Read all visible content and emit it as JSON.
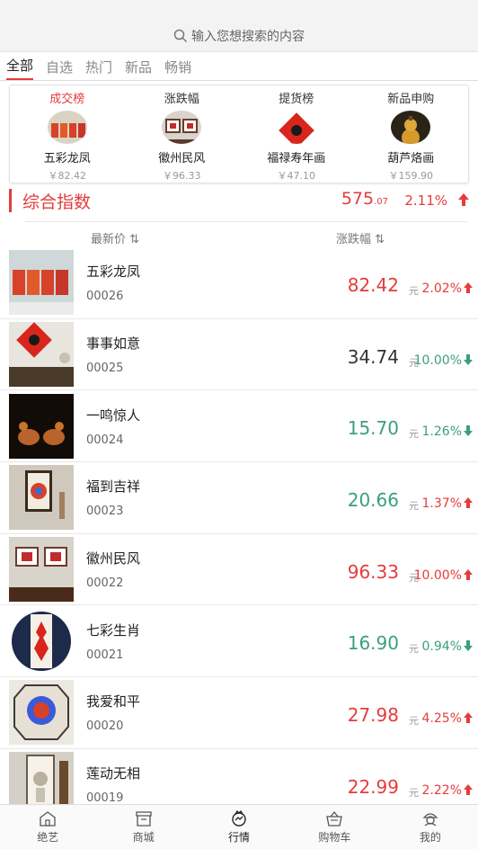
{
  "search": {
    "placeholder": "输入您想搜索的内容"
  },
  "tabs": [
    {
      "label": "全部",
      "active": true
    },
    {
      "label": "自选"
    },
    {
      "label": "热门"
    },
    {
      "label": "新品"
    },
    {
      "label": "畅销"
    }
  ],
  "rankings": [
    {
      "title": "成交榜",
      "name": "五彩龙凤",
      "price": "￥82.42",
      "active": true
    },
    {
      "title": "涨跌幅",
      "name": "徽州民风",
      "price": "￥96.33"
    },
    {
      "title": "提货榜",
      "name": "福禄寿年画",
      "price": "￥47.10"
    },
    {
      "title": "新品申购",
      "name": "葫芦烙画",
      "price": "￥159.90"
    }
  ],
  "index": {
    "title": "综合指数",
    "value_main": "575",
    "value_decimal": ".07",
    "change": "2.11%"
  },
  "sort": {
    "price_label": "最新价 ⇅",
    "change_label": "涨跌幅 ⇅"
  },
  "products": [
    {
      "name": "五彩龙凤",
      "code": "00026",
      "price": "82.42",
      "unit": "元",
      "change": "2.02%",
      "dir": "up"
    },
    {
      "name": "事事如意",
      "code": "00025",
      "price": "34.74",
      "unit": "元",
      "change": "10.00%",
      "dir": "down"
    },
    {
      "name": "一鸣惊人",
      "code": "00024",
      "price": "15.70",
      "unit": "元",
      "change": "1.26%",
      "dir": "down"
    },
    {
      "name": "福到吉祥",
      "code": "00023",
      "price": "20.66",
      "unit": "元",
      "change": "1.37%",
      "dir": "up"
    },
    {
      "name": "徽州民风",
      "code": "00022",
      "price": "96.33",
      "unit": "元",
      "change": "10.00%",
      "dir": "up"
    },
    {
      "name": "七彩生肖",
      "code": "00021",
      "price": "16.90",
      "unit": "元",
      "change": "0.94%",
      "dir": "down"
    },
    {
      "name": "我爱和平",
      "code": "00020",
      "price": "27.98",
      "unit": "元",
      "change": "4.25%",
      "dir": "up"
    },
    {
      "name": "莲动无相",
      "code": "00019",
      "price": "22.99",
      "unit": "元",
      "change": "2.22%",
      "dir": "up"
    }
  ],
  "tabbar": [
    {
      "label": "绝艺",
      "icon": "house-icon"
    },
    {
      "label": "商城",
      "icon": "store-icon"
    },
    {
      "label": "行情",
      "icon": "market-icon",
      "active": true
    },
    {
      "label": "购物车",
      "icon": "cart-icon"
    },
    {
      "label": "我的",
      "icon": "profile-icon"
    }
  ],
  "colors": {
    "accent": "#e53b3b",
    "down": "#3aa07a"
  }
}
